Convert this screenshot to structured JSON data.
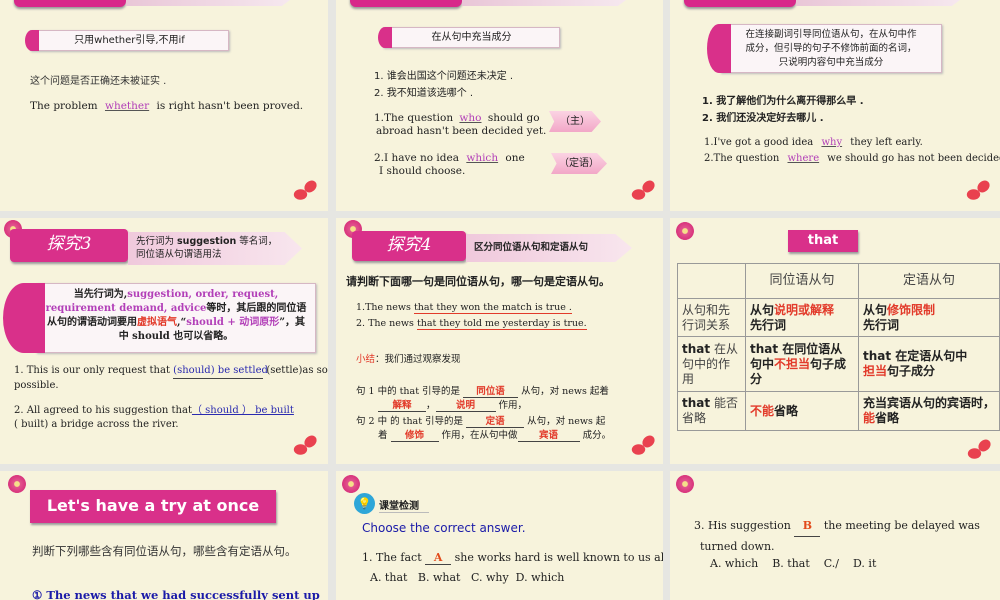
{
  "slides": [
    {
      "box": "只用whether引导,不用if",
      "cn_sentence": "这个问题是否正确还未被证实 .",
      "en_pre": "The problem ",
      "answer": "whether",
      "en_post": " is right hasn't been proved."
    },
    {
      "box": "在从句中充当成分",
      "cn_lines": [
        "1. 谁会出国这个问题还未决定 .",
        "2. 我不知道该选哪个 ."
      ],
      "q1_pre": "1.The question ",
      "q1_answer": "who",
      "q1_post": " should go",
      "q1_line2": "abroad hasn't been decided yet.",
      "q2_pre": "2.I have no idea ",
      "q2_answer": "which",
      "q2_post": " one",
      "q2_line2": "I should choose.",
      "tag1": "（主）",
      "tag2": "（定语）"
    },
    {
      "box": [
        "在连接副词引导同位语从句，在从句中作",
        "成分，但引导的句子不修饰前面的名词，",
        "只说明内容句中充当成分"
      ],
      "cn_lines": [
        "1. 我了解他们为什么离开得那么早 .",
        "2. 我们还没决定好去哪儿 ."
      ],
      "q1_pre": "1.I've got a good idea ",
      "q1_answer": "why",
      "q1_post": " they left early.",
      "q2_pre": "2.The question ",
      "q2_answer": "where",
      "q2_post": " we should go has not been decided."
    },
    {
      "header": "探究3",
      "subtitle_a": "先行词为 ",
      "subtitle_b": "suggestion",
      "subtitle_c": " 等名词，",
      "subtitle_d": "同位语从句谓语用法",
      "rule_a": "当先行词为,",
      "rule_b": "suggestion, order, request, requirement demand, advice",
      "rule_c": "等时，其后跟的同位语从句的谓语动词要用",
      "rule_d": "虚拟语气",
      "rule_e": ",“",
      "rule_f": "should + 动词原形",
      "rule_g": "”，其中",
      "rule_h": "should",
      "rule_i": " 也可以省略。",
      "q1_pre": "1. This is our only request that ",
      "q1_answer": "(should) be settled",
      "q1_post": "(settle)as soon as",
      "q1_line2": "possible.",
      "q2_pre": "2. All agreed to his suggestion that",
      "q2_answer": "（ should ） be built",
      "q2_line2": "( built)  a bridge across the river."
    },
    {
      "header": "探究4",
      "subtitle": "区分同位语从句和定语从句",
      "question": "请判断下面哪一句是同位语从句，哪一句是定语从句。",
      "s1_pre": "1.The news ",
      "s1_ul": "that they won the match is  true .",
      "s2_pre": "2. The news ",
      "s2_ul": "that they told me yesterday is  true.",
      "summary_label": "小结",
      "summary_text": "：我们通过观察发现",
      "l1_a": "句 1 中的 that  引导的是 ",
      "l1_b": "同位语",
      "l1_c": " 从句，对 news  起着",
      "l2_a": "解释",
      "l2_b": "说明",
      "l2_c": " 作用，",
      "l3_a": "句 2 中 的  that  引导的是 ",
      "l3_b": "定语",
      "l3_c": " 从句，对  news  起",
      "l4_a": "着 ",
      "l4_b": "修饰",
      "l4_c": " 作用，在从句中做",
      "l4_d": "宾语",
      "l4_e": " 成分。"
    },
    {
      "tab": "that",
      "table": {
        "headers": [
          "",
          "同位语从句",
          "定语从句"
        ],
        "r1": {
          "label": "从句和先行词关系",
          "a1": "从句",
          "a2": "说明或解释",
          "a3": "先行词",
          "b1": "从句",
          "b2": "修饰限制",
          "b3": "先行词"
        },
        "r2": {
          "label_b": "that",
          "label": " 在从句中的作用",
          "a1": "that 在同位语从句中",
          "a2": "不担当",
          "a3": "句子成分",
          "b1": "that 在定语从句中",
          "b2": "担当",
          "b3": "句子成分"
        },
        "r3": {
          "label_b": "that",
          "label": " 能否省略",
          "a1": "不能",
          "a2": "省略",
          "b1": "充当宾语从句的宾语时，",
          "b2": "能",
          "b3": "省略"
        }
      }
    },
    {
      "header": "Let's have a try at once",
      "instruction": "判断下列哪些含有同位语从句，哪些含有定语从句。",
      "item1": "① The news that we had successfully sent up"
    },
    {
      "section": "课堂检测",
      "instruction": "Choose the correct answer.",
      "q1_pre": "1. The fact ",
      "q1_answer": "A",
      "q1_post": " she works hard is  well known to us all.",
      "q1_options": "A. that   B. what   C. why  D. which"
    },
    {
      "q3_pre": "3. His suggestion ",
      "q3_answer": "B",
      "q3_post": " the meeting be delayed was",
      "q3_line2": "turned down.",
      "q3_options": [
        "A. which",
        "B. that",
        "C./",
        "D. it"
      ]
    }
  ],
  "colors": {
    "accent": "#d9308a",
    "answer": "#b23fb8",
    "red": "#e23a2a",
    "blue": "#1a1aa8"
  }
}
